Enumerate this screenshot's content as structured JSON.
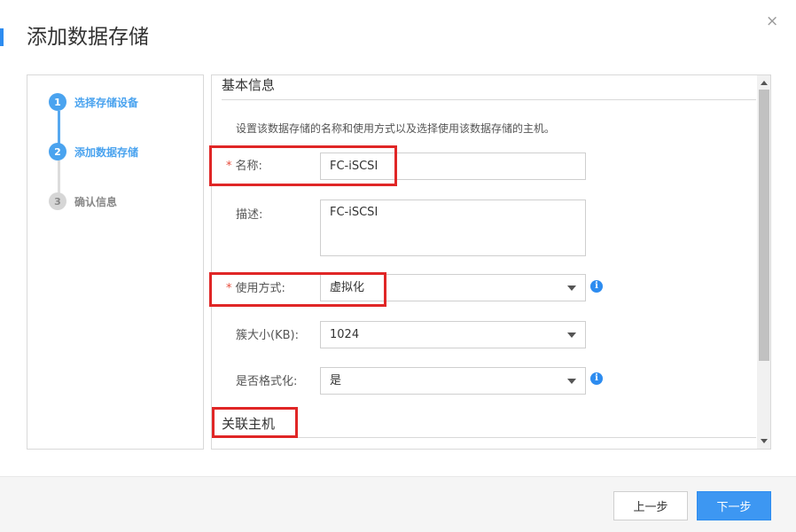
{
  "dialog": {
    "title": "添加数据存储",
    "close_glyph": "×"
  },
  "steps": [
    {
      "num": "1",
      "label": "选择存储设备"
    },
    {
      "num": "2",
      "label": "添加数据存储"
    },
    {
      "num": "3",
      "label": "确认信息"
    }
  ],
  "form": {
    "basic_section_title": "基本信息",
    "hint": "设置该数据存储的名称和使用方式以及选择使用该数据存储的主机。",
    "required_mark": "*",
    "name_label": "名称:",
    "name_value": "FC-iSCSI",
    "desc_label": "描述:",
    "desc_value": "FC-iSCSI",
    "usage_label": "使用方式:",
    "usage_value": "虚拟化",
    "cluster_label": "簇大小(KB):",
    "cluster_value": "1024",
    "format_label": "是否格式化:",
    "format_value": "是",
    "info_glyph": "i",
    "hosts_section_title": "关联主机"
  },
  "footer": {
    "prev_label": "上一步",
    "next_label": "下一步"
  },
  "colors": {
    "accent": "#2d8cf0",
    "step_active": "#4aa3ef",
    "highlight": "#e02626",
    "required": "#e74c3c"
  }
}
